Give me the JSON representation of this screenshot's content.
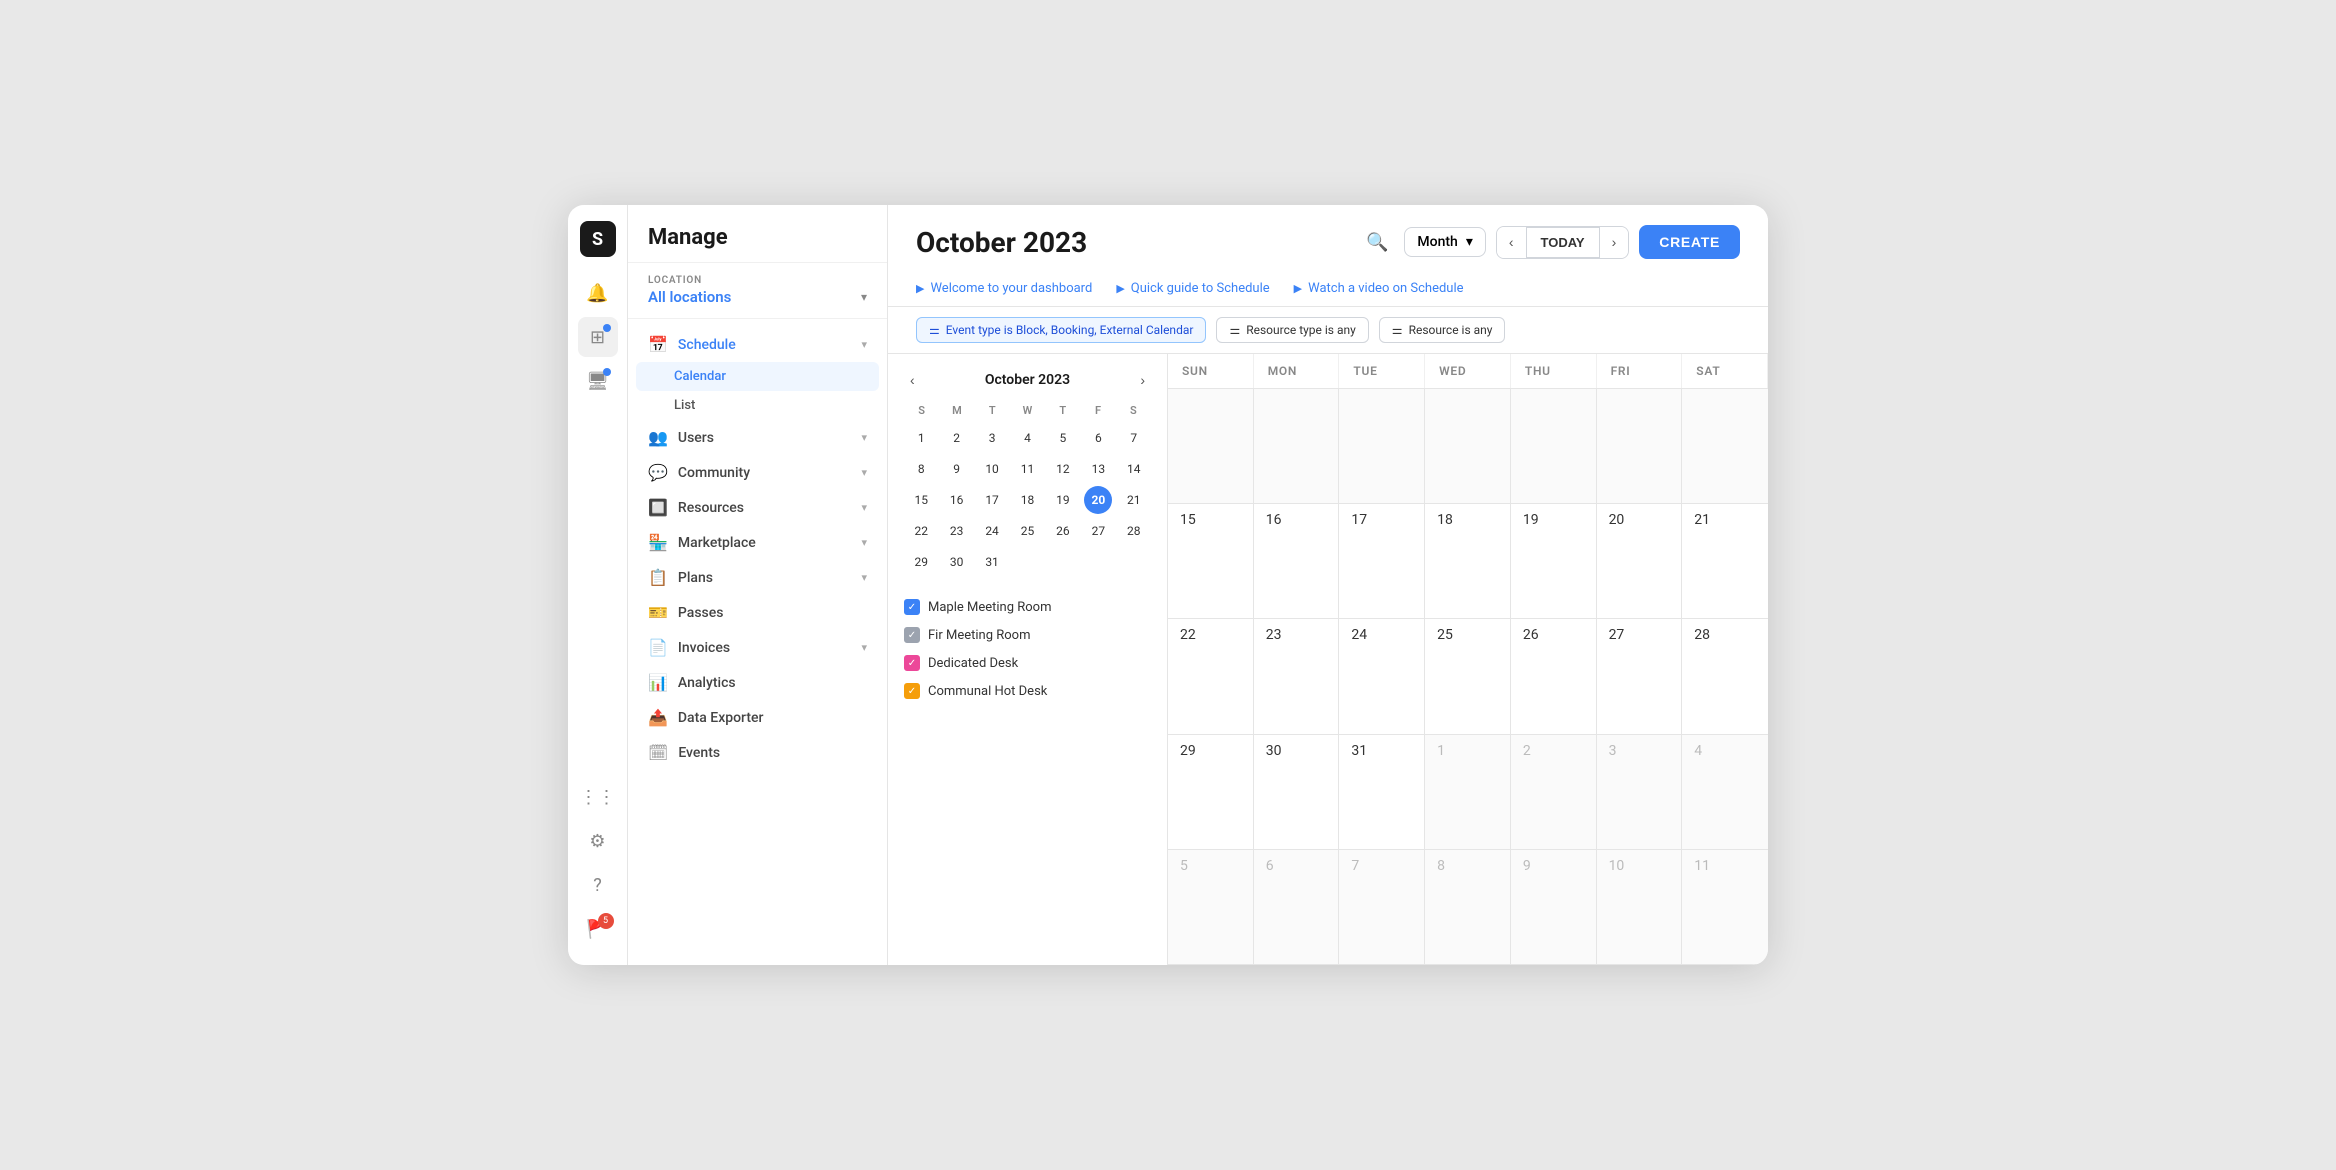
{
  "app": {
    "logo": "S",
    "title": "Manage"
  },
  "sidebar": {
    "location_label": "LOCATION",
    "location_name": "All locations",
    "nav_items": [
      {
        "id": "schedule",
        "label": "Schedule",
        "icon": "📅",
        "active": true,
        "expanded": true,
        "sub_items": [
          {
            "id": "calendar",
            "label": "Calendar",
            "active": true
          },
          {
            "id": "list",
            "label": "List",
            "active": false
          }
        ]
      },
      {
        "id": "users",
        "label": "Users",
        "icon": "👥",
        "active": false
      },
      {
        "id": "community",
        "label": "Community",
        "icon": "💬",
        "active": false
      },
      {
        "id": "resources",
        "label": "Resources",
        "icon": "🔲",
        "active": false
      },
      {
        "id": "marketplace",
        "label": "Marketplace",
        "icon": "🏪",
        "active": false
      },
      {
        "id": "plans",
        "label": "Plans",
        "icon": "📋",
        "active": false
      },
      {
        "id": "passes",
        "label": "Passes",
        "icon": "🎫",
        "active": false
      },
      {
        "id": "invoices",
        "label": "Invoices",
        "icon": "📄",
        "active": false
      },
      {
        "id": "analytics",
        "label": "Analytics",
        "icon": "📊",
        "active": false
      },
      {
        "id": "data-exporter",
        "label": "Data Exporter",
        "icon": "📤",
        "active": false
      },
      {
        "id": "events",
        "label": "Events",
        "icon": "🗓",
        "active": false
      }
    ]
  },
  "header": {
    "title": "October 2023",
    "view_label": "Month",
    "today_label": "TODAY",
    "create_label": "CREATE",
    "links": [
      {
        "id": "welcome",
        "label": "Welcome to your dashboard",
        "icon": "▶"
      },
      {
        "id": "quick-guide",
        "label": "Quick guide to Schedule",
        "icon": "▶"
      },
      {
        "id": "video",
        "label": "Watch a video on Schedule",
        "icon": "▶"
      }
    ]
  },
  "filters": [
    {
      "id": "event-type",
      "label": "Event type is Block, Booking, External Calendar",
      "active": true
    },
    {
      "id": "resource-type",
      "label": "Resource type is any",
      "active": false
    },
    {
      "id": "resource",
      "label": "Resource is any",
      "active": false
    }
  ],
  "mini_calendar": {
    "title": "October 2023",
    "day_headers": [
      "S",
      "M",
      "T",
      "W",
      "T",
      "F",
      "S"
    ],
    "dates": [
      {
        "num": "1",
        "other": false,
        "today": false
      },
      {
        "num": "2",
        "other": false,
        "today": false
      },
      {
        "num": "3",
        "other": false,
        "today": false
      },
      {
        "num": "4",
        "other": false,
        "today": false
      },
      {
        "num": "5",
        "other": false,
        "today": false
      },
      {
        "num": "6",
        "other": false,
        "today": false
      },
      {
        "num": "7",
        "other": false,
        "today": false
      },
      {
        "num": "8",
        "other": false,
        "today": false
      },
      {
        "num": "9",
        "other": false,
        "today": false
      },
      {
        "num": "10",
        "other": false,
        "today": false
      },
      {
        "num": "11",
        "other": false,
        "today": false
      },
      {
        "num": "12",
        "other": false,
        "today": false
      },
      {
        "num": "13",
        "other": false,
        "today": false
      },
      {
        "num": "14",
        "other": false,
        "today": false
      },
      {
        "num": "15",
        "other": false,
        "today": false
      },
      {
        "num": "16",
        "other": false,
        "today": false
      },
      {
        "num": "17",
        "other": false,
        "today": false
      },
      {
        "num": "18",
        "other": false,
        "today": false
      },
      {
        "num": "19",
        "other": false,
        "today": false
      },
      {
        "num": "20",
        "other": false,
        "today": true
      },
      {
        "num": "21",
        "other": false,
        "today": false
      },
      {
        "num": "22",
        "other": false,
        "today": false
      },
      {
        "num": "23",
        "other": false,
        "today": false
      },
      {
        "num": "24",
        "other": false,
        "today": false
      },
      {
        "num": "25",
        "other": false,
        "today": false
      },
      {
        "num": "26",
        "other": false,
        "today": false
      },
      {
        "num": "27",
        "other": false,
        "today": false
      },
      {
        "num": "28",
        "other": false,
        "today": false
      },
      {
        "num": "29",
        "other": false,
        "today": false
      },
      {
        "num": "30",
        "other": false,
        "today": false
      },
      {
        "num": "31",
        "other": false,
        "today": false
      }
    ]
  },
  "resources": [
    {
      "id": "maple",
      "label": "Maple Meeting Room",
      "color": "blue"
    },
    {
      "id": "fir",
      "label": "Fir Meeting Room",
      "color": "gray"
    },
    {
      "id": "dedicated",
      "label": "Dedicated Desk",
      "color": "pink"
    },
    {
      "id": "communal",
      "label": "Communal Hot Desk",
      "color": "orange"
    }
  ],
  "calendar": {
    "day_headers": [
      "SUN",
      "MON",
      "TUE",
      "WED",
      "THU",
      "FRI",
      "SAT"
    ],
    "weeks": [
      {
        "days": [
          {
            "num": "",
            "other": true
          },
          {
            "num": "",
            "other": true
          },
          {
            "num": "",
            "other": true
          },
          {
            "num": "",
            "other": true
          },
          {
            "num": "",
            "other": true
          },
          {
            "num": "",
            "other": true
          },
          {
            "num": "",
            "other": true
          }
        ]
      },
      {
        "days": [
          {
            "num": "15",
            "other": false
          },
          {
            "num": "16",
            "other": false
          },
          {
            "num": "17",
            "other": false
          },
          {
            "num": "18",
            "other": false
          },
          {
            "num": "19",
            "other": false
          },
          {
            "num": "20",
            "other": false
          },
          {
            "num": "21",
            "other": false
          }
        ]
      },
      {
        "days": [
          {
            "num": "22",
            "other": false
          },
          {
            "num": "23",
            "other": false
          },
          {
            "num": "24",
            "other": false
          },
          {
            "num": "25",
            "other": false
          },
          {
            "num": "26",
            "other": false
          },
          {
            "num": "27",
            "other": false
          },
          {
            "num": "28",
            "other": false
          }
        ]
      },
      {
        "days": [
          {
            "num": "29",
            "other": false
          },
          {
            "num": "30",
            "other": false
          },
          {
            "num": "31",
            "other": false
          },
          {
            "num": "1",
            "other": true
          },
          {
            "num": "2",
            "other": true
          },
          {
            "num": "3",
            "other": true
          },
          {
            "num": "4",
            "other": true
          }
        ]
      },
      {
        "days": [
          {
            "num": "5",
            "other": true
          },
          {
            "num": "6",
            "other": true
          },
          {
            "num": "7",
            "other": true
          },
          {
            "num": "8",
            "other": true
          },
          {
            "num": "9",
            "other": true
          },
          {
            "num": "10",
            "other": true
          },
          {
            "num": "11",
            "other": true
          }
        ]
      }
    ]
  },
  "icon_bar": {
    "items": [
      {
        "id": "bell",
        "icon": "🔔",
        "badge": null
      },
      {
        "id": "grid",
        "icon": "⊞",
        "dot": true
      },
      {
        "id": "monitor",
        "icon": "🖥",
        "dot": true
      },
      {
        "id": "apps",
        "icon": "⋮⋮",
        "badge": null
      },
      {
        "id": "settings",
        "icon": "⚙",
        "badge": null
      },
      {
        "id": "help",
        "icon": "?",
        "badge": null
      },
      {
        "id": "flag",
        "icon": "🚩",
        "badge": "5"
      }
    ]
  }
}
